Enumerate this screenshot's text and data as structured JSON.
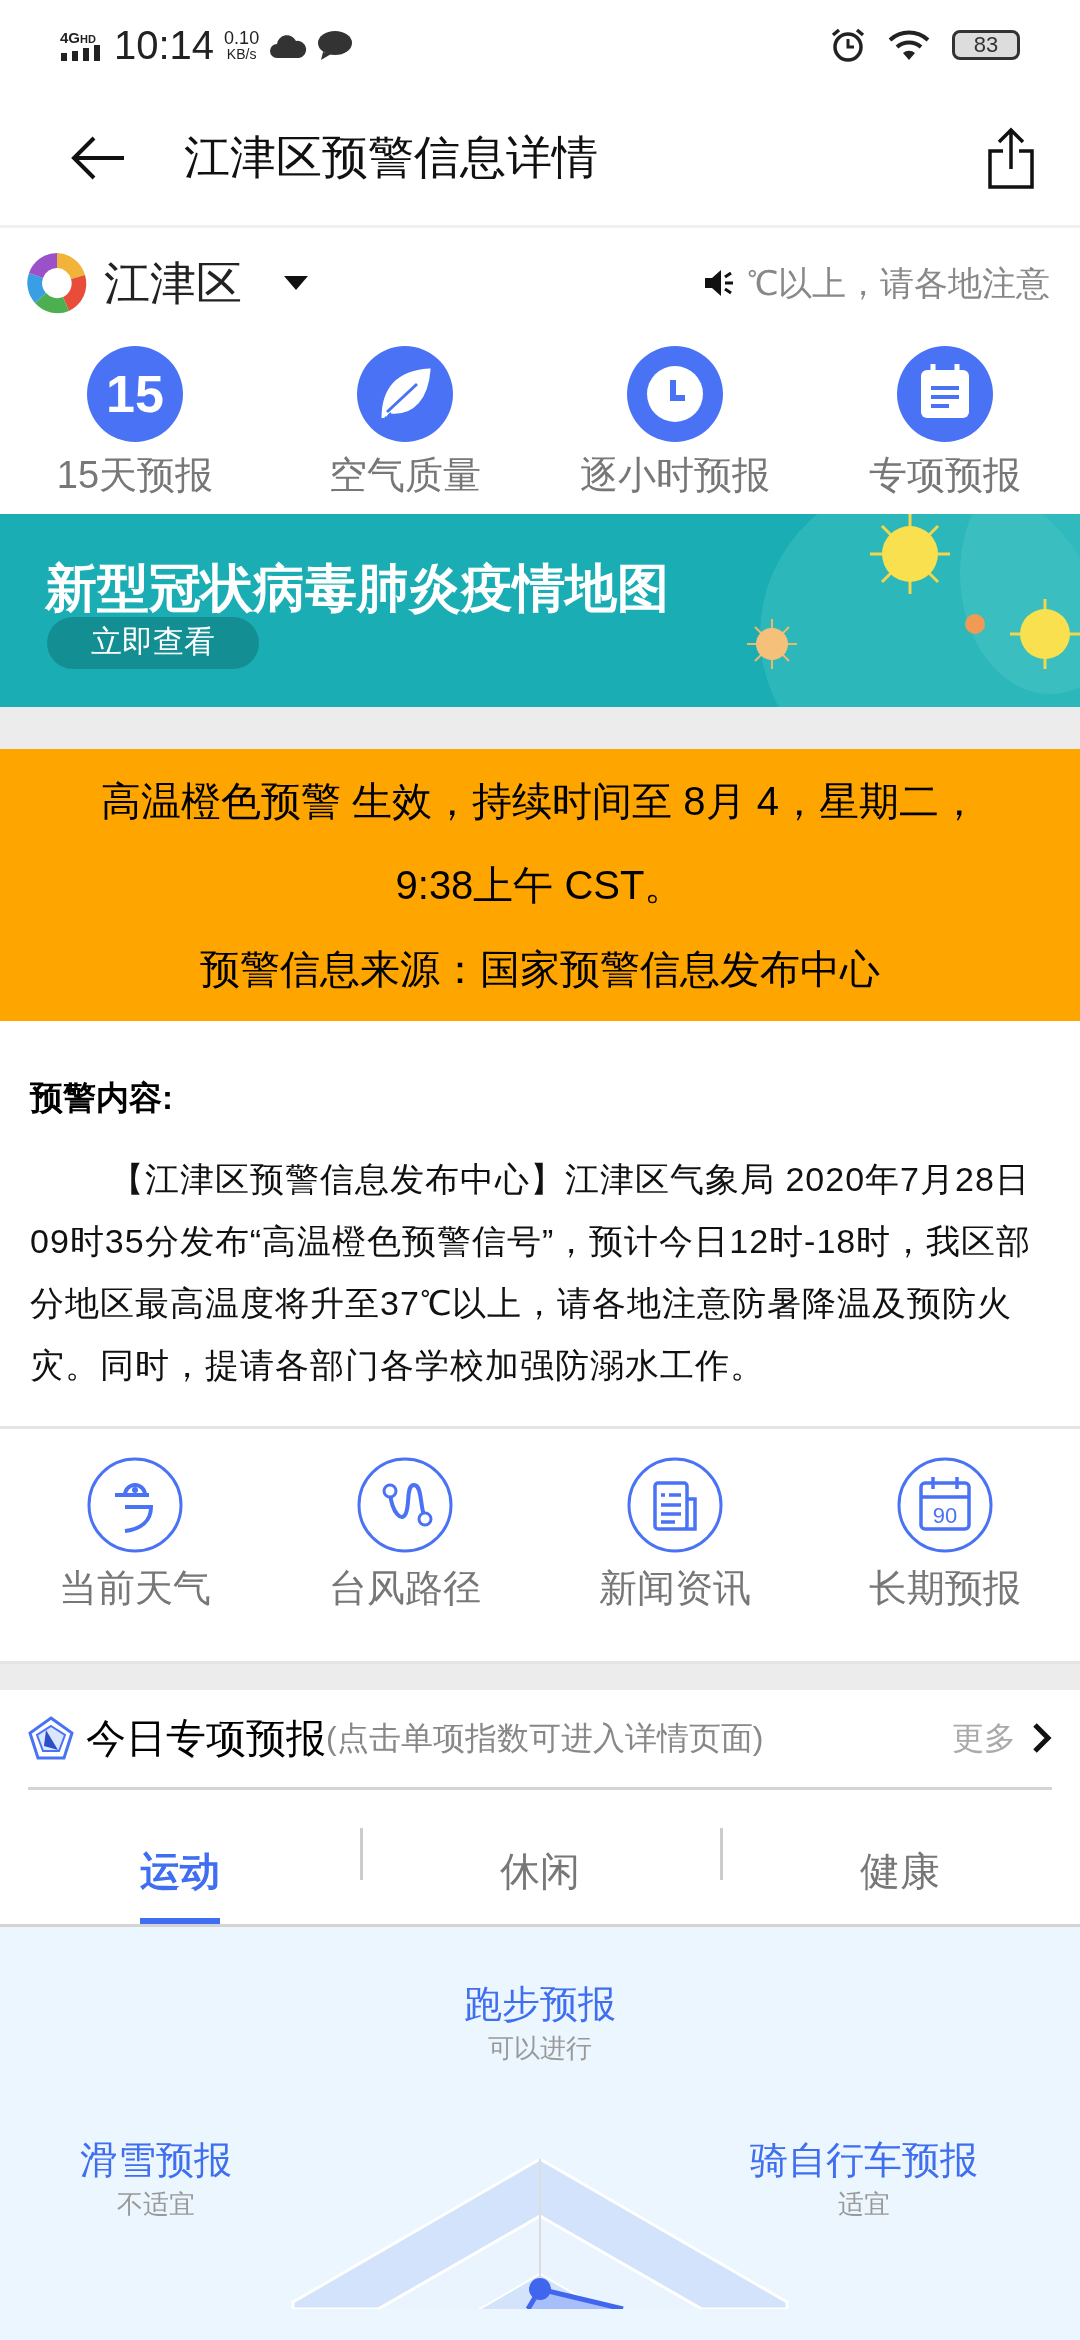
{
  "status_bar": {
    "network": "4G",
    "network_badge": "HD",
    "time": "10:14",
    "speed": "0.10",
    "speed_unit": "KB/s",
    "battery": "83"
  },
  "header": {
    "title": "江津区预警信息详情"
  },
  "location": {
    "name": "江津区",
    "ticker": "℃以上，请各地注意"
  },
  "quick_links": [
    {
      "label": "15天预报",
      "icon_text": "15"
    },
    {
      "label": "空气质量"
    },
    {
      "label": "逐小时预报"
    },
    {
      "label": "专项预报"
    }
  ],
  "banner": {
    "kind": "picture",
    "title": "新型冠状病毒肺炎疫情地图",
    "button": "立即查看"
  },
  "alert": {
    "lines": [
      "高温橙色预警 生效，持续时间至 8月 4，星期二，9:38上午 CST。",
      "预警信息来源：国家预警信息发布中心"
    ],
    "color": "#fea500"
  },
  "content": {
    "heading": "预警内容:",
    "body": "【江津区预警信息发布中心】江津区气象局 2020年7月28日09时35分发布“高温橙色预警信号”，预计今日12时-18时，我区部分地区最高温度将升至37℃以上，请各地注意防暑降温及预防火灾。同时，提请各部门各学校加强防溺水工作。"
  },
  "features": [
    {
      "label": "当前天气"
    },
    {
      "label": "台风路径"
    },
    {
      "label": "新闻资讯"
    },
    {
      "label": "长期预报",
      "icon_text": "90"
    }
  ],
  "special": {
    "title": "今日专项预报",
    "hint": "(点击单项指数可进入详情页面)",
    "more": "更多",
    "tabs": [
      {
        "label": "运动",
        "selected": true
      },
      {
        "label": "休闲",
        "selected": false
      },
      {
        "label": "健康",
        "selected": false
      }
    ],
    "indices": [
      {
        "name": "跑步预报",
        "rating": "可以进行"
      },
      {
        "name": "滑雪预报",
        "rating": "不适宜"
      },
      {
        "name": "骑自行车预报",
        "rating": "适宜"
      }
    ]
  }
}
